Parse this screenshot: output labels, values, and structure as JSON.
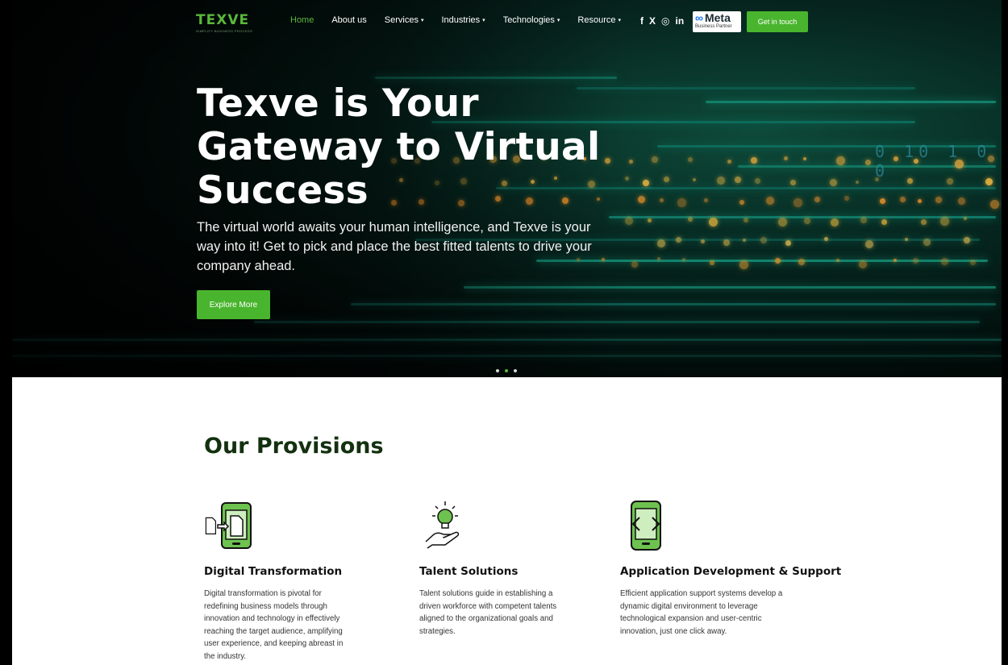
{
  "nav": {
    "logo": "TEXVE",
    "logo_tagline": "SIMPLIFY BUSINESS PROCESS",
    "items": [
      {
        "label": "Home",
        "active": true,
        "dropdown": false
      },
      {
        "label": "About us",
        "active": false,
        "dropdown": false
      },
      {
        "label": "Services",
        "active": false,
        "dropdown": true
      },
      {
        "label": "Industries",
        "active": false,
        "dropdown": true
      },
      {
        "label": "Technologies",
        "active": false,
        "dropdown": true
      },
      {
        "label": "Resource",
        "active": false,
        "dropdown": true
      }
    ],
    "social": [
      "facebook-icon",
      "x-icon",
      "instagram-icon",
      "linkedin-icon"
    ],
    "social_glyphs": [
      "f",
      "X",
      "◎",
      "in"
    ],
    "meta_badge": {
      "brand": "Meta",
      "subtitle": "Business Partner"
    },
    "cta": "Get in touch"
  },
  "hero": {
    "title": "Texve is Your Gateway to Virtual Success",
    "subtitle": "The virtual world awaits your human intelligence, and Texve is your way into it! Get to pick and place the best fitted talents to drive your company ahead.",
    "button": "Explore More",
    "slides": 3,
    "active_slide": 1,
    "background_digits": "0  10 1 0 0"
  },
  "provisions": {
    "title": "Our Provisions",
    "cards": [
      {
        "icon": "digital-transformation-icon",
        "title": "Digital Transformation",
        "text": "Digital transformation is pivotal for redefining business models through innovation and technology in effectively reaching the target audience, amplifying user experience, and keeping abreast in the industry."
      },
      {
        "icon": "lightbulb-hand-icon",
        "title": "Talent Solutions",
        "text": "Talent solutions guide in establishing a driven workforce with competent talents aligned to the organizational goals and strategies."
      },
      {
        "icon": "mobile-code-icon",
        "title": "Application Development & Support",
        "text": "Efficient application support systems develop a dynamic digital environment to leverage technological expansion and user-centric innovation, just one click away."
      }
    ]
  },
  "colors": {
    "accent": "#49b52e",
    "heading": "#13310f"
  }
}
